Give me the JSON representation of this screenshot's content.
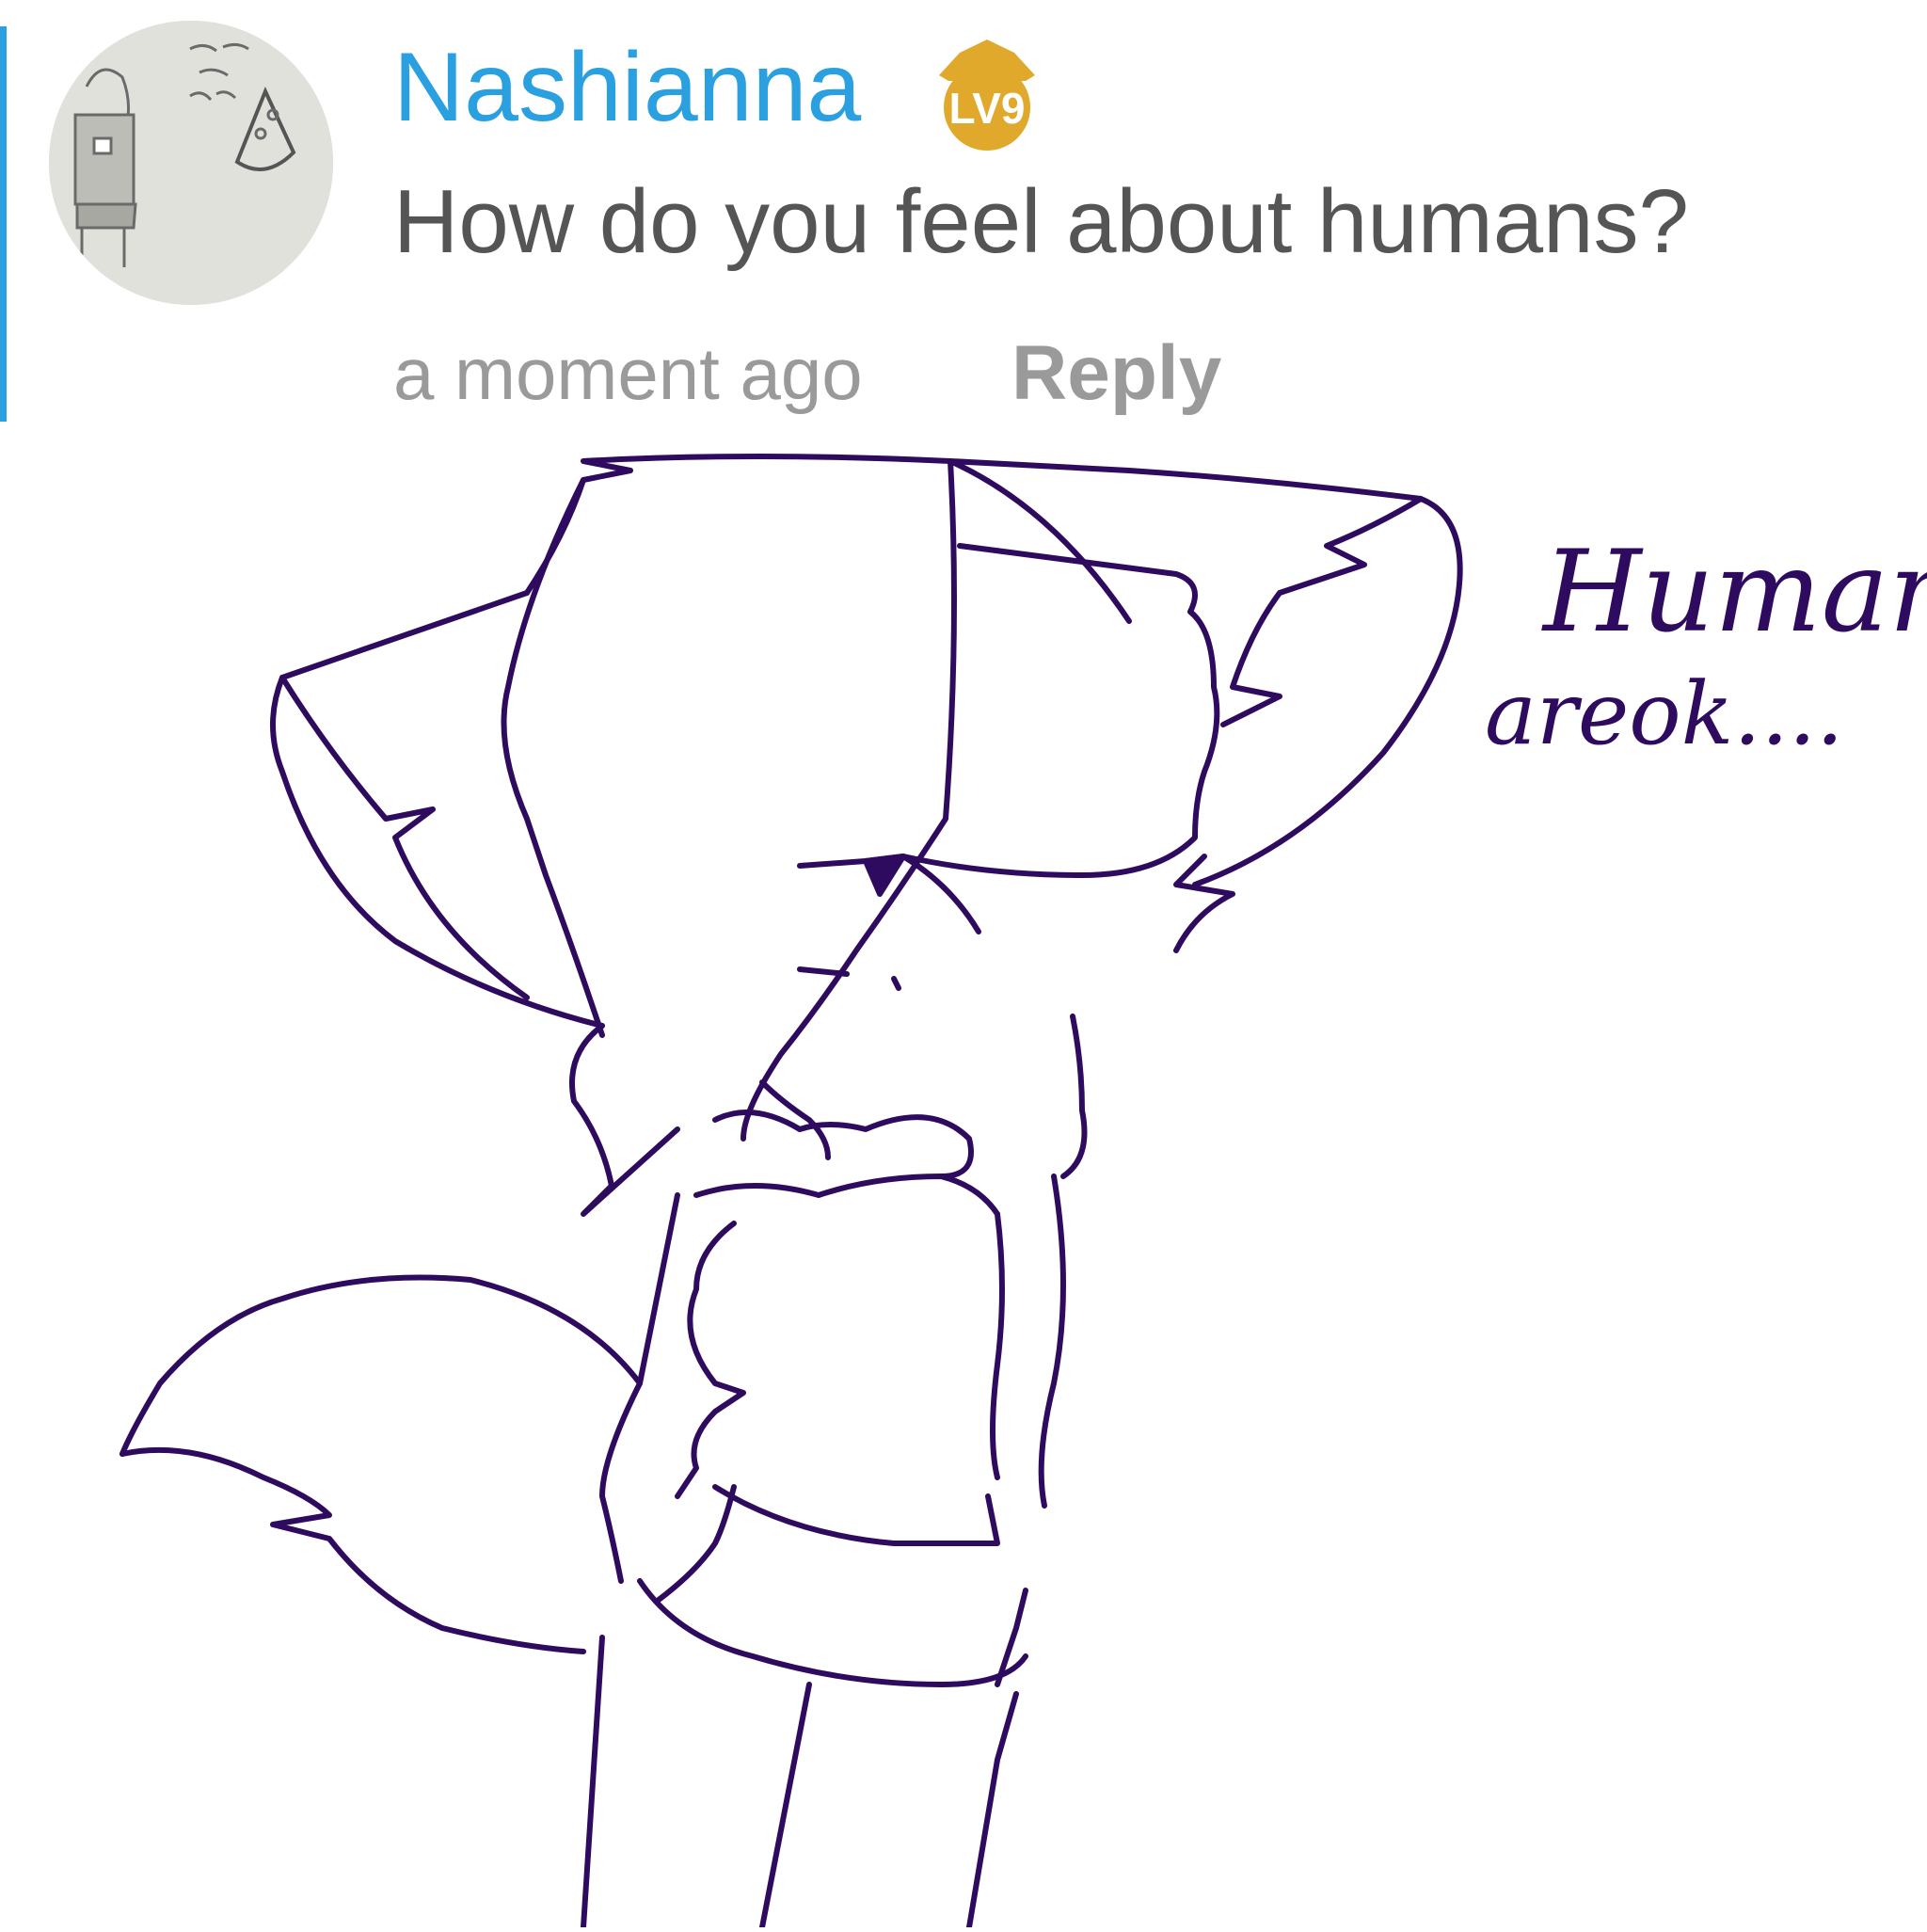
{
  "comment": {
    "username": "Nashianna",
    "level_badge": "LV9",
    "message": "How do you feel about humans?",
    "timestamp": "a moment ago",
    "reply_label": "Reply"
  },
  "drawing": {
    "caption_line1": "Humans",
    "caption_line2": "areok....",
    "ink_color": "#2e0b5e"
  },
  "colors": {
    "accent": "#2aa0e0",
    "badge": "#e0a92b",
    "message_text": "#555555",
    "meta_text": "#9a9a9a"
  },
  "icons": {
    "level": "crown-badge-icon"
  }
}
